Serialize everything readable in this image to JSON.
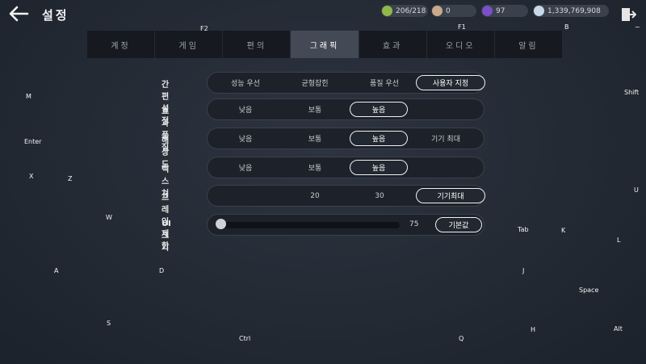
{
  "header": {
    "title": "설정"
  },
  "resources": [
    {
      "id": "energy",
      "value": "206/218",
      "color": "#8fb84a"
    },
    {
      "id": "coin",
      "value": "0",
      "color": "#c9a98c"
    },
    {
      "id": "gem",
      "value": "97",
      "color": "#7a4fc8"
    },
    {
      "id": "silver",
      "value": "1,339,769,908",
      "color": "#c8d8e8"
    }
  ],
  "tabs": [
    "계정",
    "게임",
    "편의",
    "그래픽",
    "효과",
    "오디오",
    "알림"
  ],
  "active_tab": "그래픽",
  "settings": {
    "preset": {
      "label": "간편 설정",
      "options": [
        "성능 우선",
        "균형잡힌",
        "품질 우선",
        "사용자 지정"
      ],
      "selected": "사용자 지정"
    },
    "effect_quality": {
      "label": "효과 품질",
      "options": [
        "낮음",
        "보통",
        "높음"
      ],
      "selected": "높음"
    },
    "resolution": {
      "label": "해상도",
      "options": [
        "낮음",
        "보통",
        "높음",
        "기기 최대"
      ],
      "selected": "높음"
    },
    "texture": {
      "label": "텍스쳐",
      "options": [
        "낮음",
        "보통",
        "높음"
      ],
      "selected": "높음"
    },
    "frame_limit": {
      "label": "프레임 제한",
      "options": [
        "20",
        "30",
        "기기최대"
      ],
      "selected": "기기최대"
    },
    "ui_scale": {
      "label": "UI 크기",
      "value": "75",
      "reset_label": "기본값",
      "fraction": 0.0
    }
  },
  "key_hints": [
    "F2",
    "F1",
    "B",
    "~",
    "M",
    "Shift",
    "Enter",
    "X",
    "Z",
    "U",
    "W",
    "Tab",
    "K",
    "L",
    "A",
    "D",
    "J",
    "Space",
    "S",
    "H",
    "Alt",
    "Ctrl",
    "Q"
  ]
}
